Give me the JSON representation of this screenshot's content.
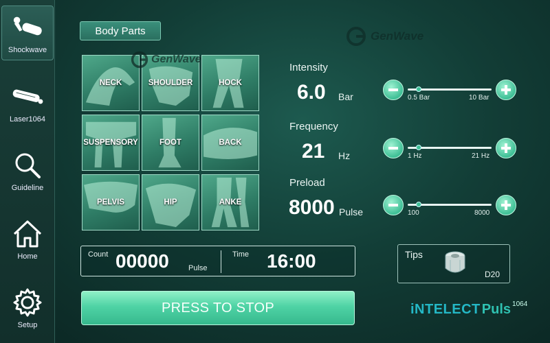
{
  "sidebar": {
    "items": [
      {
        "label": "Shockwave",
        "icon": "shockwave-handpiece-icon"
      },
      {
        "label": "Laser1064",
        "icon": "laser-probe-icon"
      },
      {
        "label": "Guideline",
        "icon": "magnifier-icon"
      },
      {
        "label": "Home",
        "icon": "home-icon"
      },
      {
        "label": "Setup",
        "icon": "gear-icon"
      }
    ]
  },
  "header": {
    "body_parts_label": "Body Parts",
    "logo_text": "GenWave"
  },
  "grid": {
    "watermark": "GenWave",
    "cells": [
      "NECK",
      "SHOULDER",
      "HOCK",
      "SUSPENSORY",
      "FOOT",
      "BACK",
      "PELVIS",
      "HIP",
      "ANKE"
    ]
  },
  "params": {
    "intensity": {
      "label": "Intensity",
      "value": "6.0",
      "unit": "Bar",
      "min": "0.5 Bar",
      "max": "10 Bar",
      "level": 0.13
    },
    "frequency": {
      "label": "Frequency",
      "value": "21",
      "unit": "Hz",
      "min": "1 Hz",
      "max": "21 Hz",
      "level": 0.13
    },
    "preload": {
      "label": "Preload",
      "value": "8000",
      "unit": "Pulse",
      "min": "100",
      "max": "8000",
      "level": 0.13
    }
  },
  "counter": {
    "count_label": "Count",
    "count_value": "00000",
    "count_unit": "Pulse",
    "time_label": "Time",
    "time_value": "16:00"
  },
  "tips": {
    "label": "Tips",
    "head": "D20"
  },
  "stop_button": "PRESS TO STOP",
  "brand": {
    "first": "iNTELECT",
    "second": "Puls",
    "sup": "1064"
  },
  "colors": {
    "accent": "#3fbf96",
    "background": "#123d36"
  }
}
